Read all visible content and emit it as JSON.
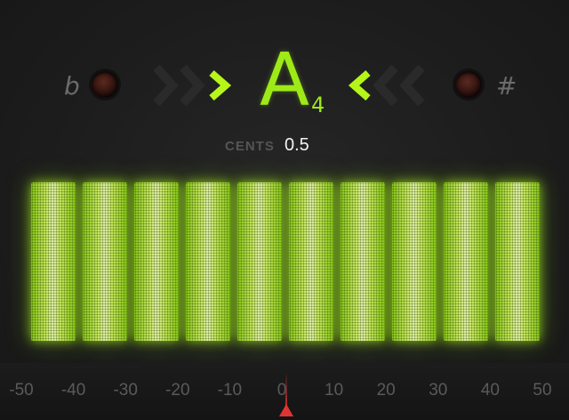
{
  "tuner": {
    "flat_symbol": "b",
    "sharp_symbol": "#",
    "note": "A",
    "octave": "4",
    "cents_label": "CENTS",
    "cents_value": "0.5"
  },
  "meter": {
    "bar_count": 10,
    "active_color": "#c6f03c"
  },
  "scale": {
    "labels": [
      "-50",
      "-40",
      "-30",
      "-20",
      "-10",
      "0",
      "10",
      "20",
      "30",
      "40",
      "50"
    ]
  },
  "colors": {
    "accent": "#9eea17",
    "needle": "#e03434",
    "background": "#1d1d1d"
  },
  "icons": {
    "flat": "flat-icon",
    "sharp": "sharp-icon",
    "left_led": "led-indicator-icon",
    "right_led": "led-indicator-icon",
    "left_arrows": "chevron-right-icon",
    "right_arrows": "chevron-left-icon",
    "needle": "pointer-triangle-icon"
  }
}
